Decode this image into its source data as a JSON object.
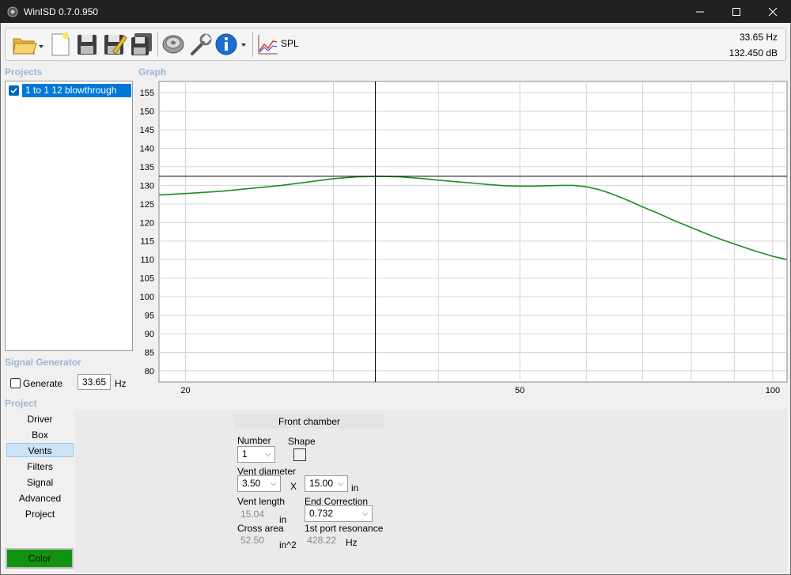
{
  "window": {
    "title": "WinISD 0.7.0.950"
  },
  "toolbar": {
    "spl_label": "SPL",
    "freq_readout": "33.65 Hz",
    "db_readout": "132.450 dB"
  },
  "projects": {
    "section_label": "Projects",
    "items": [
      {
        "label": "1 to 1 12 blowthrough",
        "checked": true
      }
    ]
  },
  "graph": {
    "section_label": "Graph"
  },
  "signal_generator": {
    "section_label": "Signal Generator",
    "generate_label": "Generate",
    "frequency_value": "33.65",
    "unit": "Hz"
  },
  "project_nav": {
    "section_label": "Project",
    "items": [
      "Driver",
      "Box",
      "Vents",
      "Filters",
      "Signal",
      "Advanced",
      "Project"
    ],
    "active": "Vents",
    "color_button": "Color"
  },
  "vents_panel": {
    "header": "Front chamber",
    "number_label": "Number",
    "number_value": "1",
    "shape_label": "Shape",
    "vent_diameter_label": "Vent diameter",
    "vent_diameter_value": "3.50",
    "x_label": "X",
    "vent_width_value": "15.00",
    "diameter_unit": "in",
    "vent_length_label": "Vent length",
    "vent_length_value": "15.04",
    "vent_length_unit": "in",
    "end_correction_label": "End Correction",
    "end_correction_value": "0.732",
    "cross_area_label": "Cross area",
    "cross_area_value": "52.50",
    "cross_area_unit": "in^2",
    "port_resonance_label": "1st port resonance",
    "port_resonance_value": "428.22",
    "port_resonance_unit": "Hz"
  },
  "colors": {
    "curve": "#1e8c1e",
    "accent": "#0078d7",
    "section_label": "#9bb7d5",
    "color_swatch": "#119211"
  },
  "chart_data": {
    "type": "line",
    "x_scale": "log",
    "xlim": [
      18.6,
      104
    ],
    "ylim": [
      77,
      158
    ],
    "x_ticks": [
      20,
      50,
      100
    ],
    "y_ticks": [
      80,
      85,
      90,
      95,
      100,
      105,
      110,
      115,
      120,
      125,
      130,
      135,
      140,
      145,
      150,
      155
    ],
    "grid": true,
    "cursor": {
      "x": 33.65,
      "y": 132.45
    },
    "series": [
      {
        "x": [
          18.6,
          20,
          22,
          24,
          26,
          28,
          30,
          32,
          34,
          36,
          38,
          40,
          42,
          44,
          46,
          48,
          50,
          52,
          54,
          56,
          58,
          60,
          62,
          64,
          66,
          68,
          70,
          73,
          76,
          80,
          85,
          90,
          95,
          100,
          104
        ],
        "y": [
          127.4,
          127.8,
          128.4,
          129.2,
          130.0,
          130.9,
          131.8,
          132.3,
          132.45,
          132.3,
          131.9,
          131.4,
          131.0,
          130.6,
          130.2,
          129.9,
          129.8,
          129.8,
          129.9,
          130.0,
          130.0,
          129.6,
          128.9,
          127.9,
          126.7,
          125.5,
          124.2,
          122.5,
          120.7,
          118.6,
          116.2,
          114.2,
          112.4,
          110.9,
          110.0
        ]
      }
    ]
  }
}
